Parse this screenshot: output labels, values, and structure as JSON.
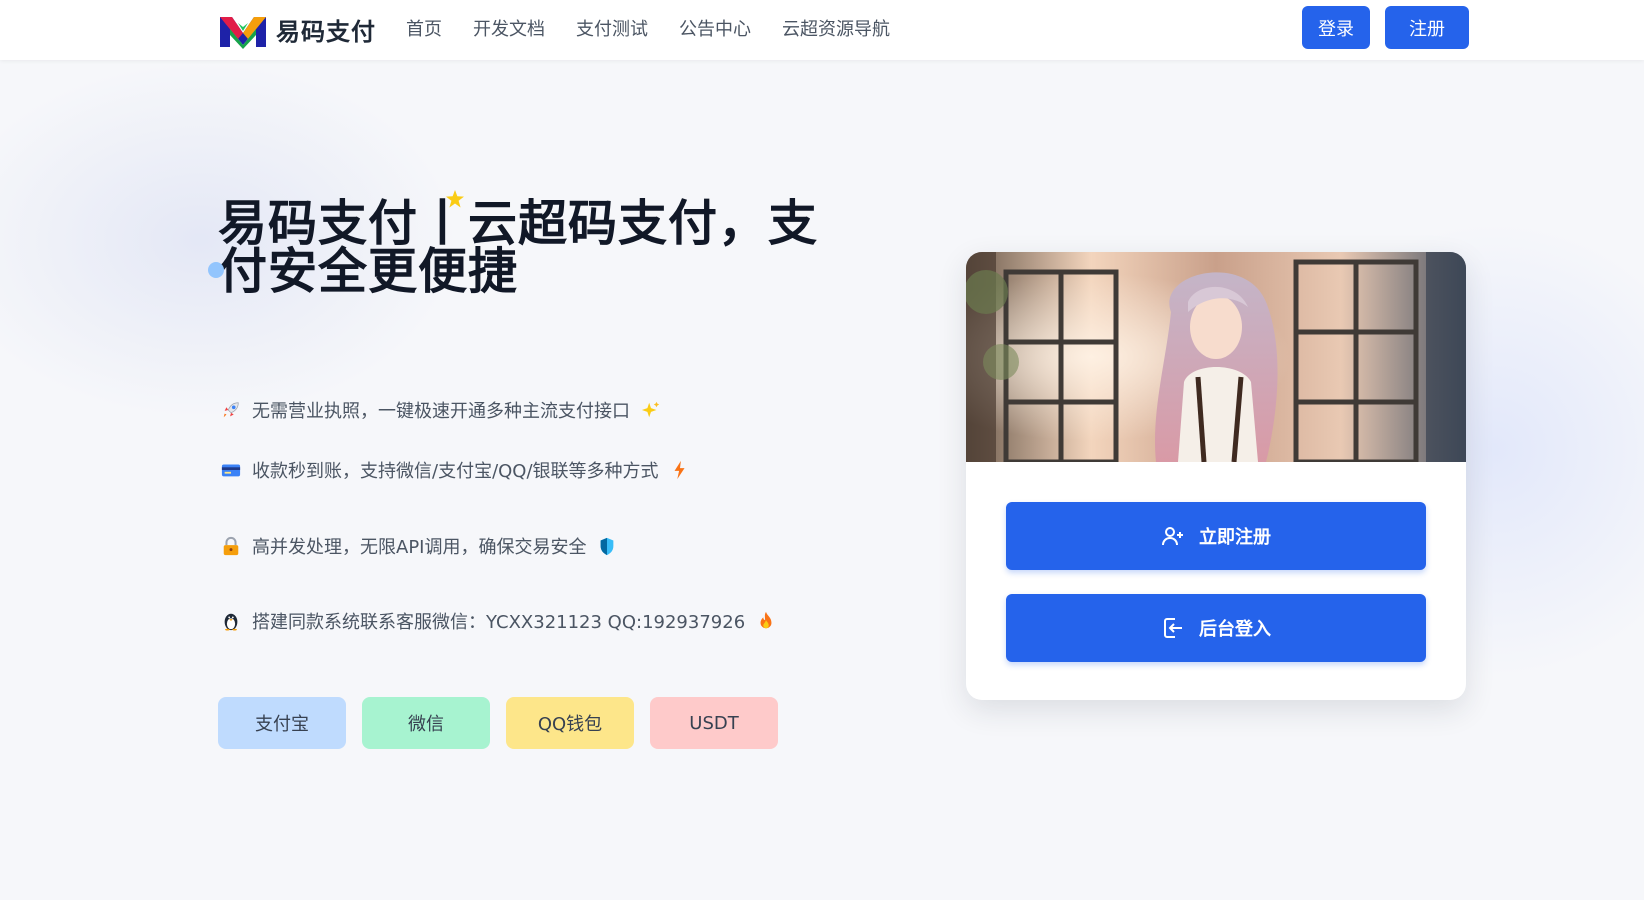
{
  "brand": {
    "name": "易码支付"
  },
  "nav": {
    "links": [
      {
        "label": "首页"
      },
      {
        "label": "开发文档"
      },
      {
        "label": "支付测试"
      },
      {
        "label": "公告中心"
      },
      {
        "label": "云超资源导航"
      }
    ],
    "login_label": "登录",
    "register_label": "注册"
  },
  "hero": {
    "title": "易码支付丨云超码支付，支付安全更便捷",
    "features": [
      {
        "icon": "rocket-icon",
        "text": "无需营业执照，一键极速开通多种主流支付接口",
        "trail_icon": "sparkles-icon"
      },
      {
        "icon": "credit-card-icon",
        "text": "收款秒到账，支持微信/支付宝/QQ/银联等多种方式",
        "trail_icon": "lightning-icon"
      },
      {
        "icon": "lock-icon",
        "text": "高并发处理，无限API调用，确保交易安全",
        "trail_icon": "shield-icon"
      },
      {
        "icon": "penguin-icon",
        "text": "搭建同款系统联系客服微信：YCXX321123 QQ:192937926",
        "trail_icon": "fire-icon"
      }
    ],
    "tags": [
      {
        "label": "支付宝",
        "color": "#bfdbfe"
      },
      {
        "label": "微信",
        "color": "#a7f3d0"
      },
      {
        "label": "QQ钱包",
        "color": "#fde68a"
      },
      {
        "label": "USDT",
        "color": "#fecaca"
      }
    ]
  },
  "card": {
    "signup_label": "立即注册",
    "admin_label": "后台登入"
  },
  "colors": {
    "accent": "#2563eb",
    "text": "#111827",
    "muted": "#4b5563",
    "background": "#f6f7fa"
  }
}
